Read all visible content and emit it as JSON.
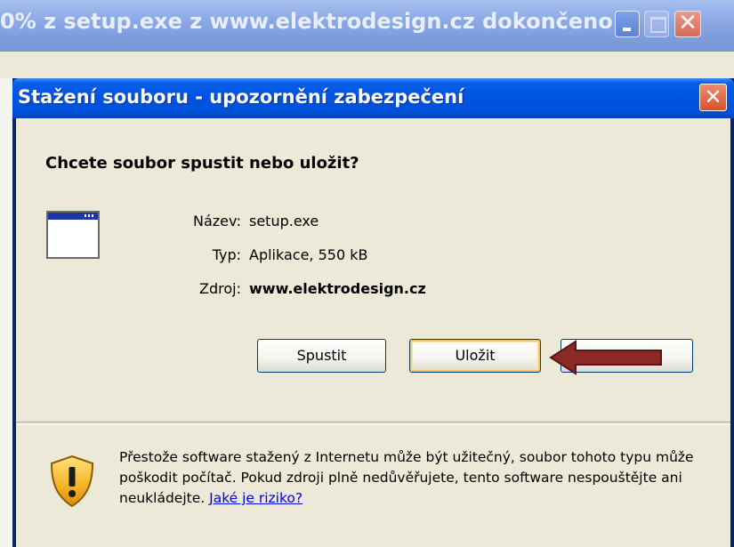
{
  "background_window": {
    "title": "0% z setup.exe z www.elektrodesign.cz dokončeno",
    "close_glyph": "✕"
  },
  "dialog": {
    "title": "Stažení souboru - upozornění zabezpečení",
    "close_glyph": "✕",
    "question": "Chcete soubor spustit nebo uložit?",
    "file_info": {
      "name_label": "Název:",
      "name_value": "setup.exe",
      "type_label": "Typ:",
      "type_value": "Aplikace, 550 kB",
      "source_label": "Zdroj:",
      "source_value": "www.elektrodesign.cz"
    },
    "buttons": {
      "run": "Spustit",
      "save": "Uložit",
      "cancel": ""
    },
    "warning_text": "Přestože software stažený z Internetu může být užitečný, soubor tohoto typu může poškodit počítač. Pokud zdroji plně nedůvěřujete, tento software nespouštějte ani neukládejte.",
    "risk_link": "Jaké je riziko?",
    "icons": [
      "application-icon",
      "shield-warning-icon",
      "arrow-annotation"
    ],
    "colors": {
      "titlebar": "#0054e3",
      "dialog_bg": "#ece9d8",
      "arrow": "#8b2a24",
      "link": "#0000ee"
    }
  }
}
